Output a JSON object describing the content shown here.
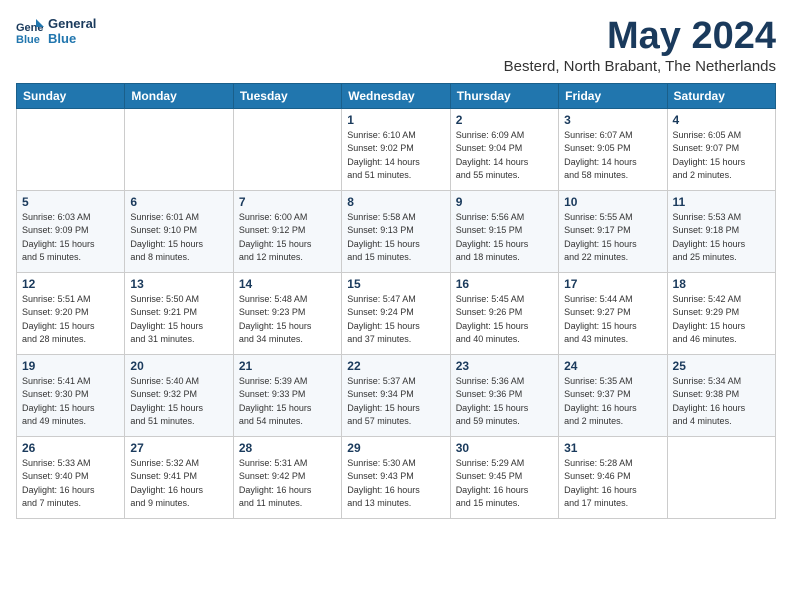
{
  "logo": {
    "line1": "General",
    "line2": "Blue"
  },
  "title": "May 2024",
  "subtitle": "Besterd, North Brabant, The Netherlands",
  "weekdays": [
    "Sunday",
    "Monday",
    "Tuesday",
    "Wednesday",
    "Thursday",
    "Friday",
    "Saturday"
  ],
  "weeks": [
    [
      {
        "day": "",
        "info": ""
      },
      {
        "day": "",
        "info": ""
      },
      {
        "day": "",
        "info": ""
      },
      {
        "day": "1",
        "info": "Sunrise: 6:10 AM\nSunset: 9:02 PM\nDaylight: 14 hours\nand 51 minutes."
      },
      {
        "day": "2",
        "info": "Sunrise: 6:09 AM\nSunset: 9:04 PM\nDaylight: 14 hours\nand 55 minutes."
      },
      {
        "day": "3",
        "info": "Sunrise: 6:07 AM\nSunset: 9:05 PM\nDaylight: 14 hours\nand 58 minutes."
      },
      {
        "day": "4",
        "info": "Sunrise: 6:05 AM\nSunset: 9:07 PM\nDaylight: 15 hours\nand 2 minutes."
      }
    ],
    [
      {
        "day": "5",
        "info": "Sunrise: 6:03 AM\nSunset: 9:09 PM\nDaylight: 15 hours\nand 5 minutes."
      },
      {
        "day": "6",
        "info": "Sunrise: 6:01 AM\nSunset: 9:10 PM\nDaylight: 15 hours\nand 8 minutes."
      },
      {
        "day": "7",
        "info": "Sunrise: 6:00 AM\nSunset: 9:12 PM\nDaylight: 15 hours\nand 12 minutes."
      },
      {
        "day": "8",
        "info": "Sunrise: 5:58 AM\nSunset: 9:13 PM\nDaylight: 15 hours\nand 15 minutes."
      },
      {
        "day": "9",
        "info": "Sunrise: 5:56 AM\nSunset: 9:15 PM\nDaylight: 15 hours\nand 18 minutes."
      },
      {
        "day": "10",
        "info": "Sunrise: 5:55 AM\nSunset: 9:17 PM\nDaylight: 15 hours\nand 22 minutes."
      },
      {
        "day": "11",
        "info": "Sunrise: 5:53 AM\nSunset: 9:18 PM\nDaylight: 15 hours\nand 25 minutes."
      }
    ],
    [
      {
        "day": "12",
        "info": "Sunrise: 5:51 AM\nSunset: 9:20 PM\nDaylight: 15 hours\nand 28 minutes."
      },
      {
        "day": "13",
        "info": "Sunrise: 5:50 AM\nSunset: 9:21 PM\nDaylight: 15 hours\nand 31 minutes."
      },
      {
        "day": "14",
        "info": "Sunrise: 5:48 AM\nSunset: 9:23 PM\nDaylight: 15 hours\nand 34 minutes."
      },
      {
        "day": "15",
        "info": "Sunrise: 5:47 AM\nSunset: 9:24 PM\nDaylight: 15 hours\nand 37 minutes."
      },
      {
        "day": "16",
        "info": "Sunrise: 5:45 AM\nSunset: 9:26 PM\nDaylight: 15 hours\nand 40 minutes."
      },
      {
        "day": "17",
        "info": "Sunrise: 5:44 AM\nSunset: 9:27 PM\nDaylight: 15 hours\nand 43 minutes."
      },
      {
        "day": "18",
        "info": "Sunrise: 5:42 AM\nSunset: 9:29 PM\nDaylight: 15 hours\nand 46 minutes."
      }
    ],
    [
      {
        "day": "19",
        "info": "Sunrise: 5:41 AM\nSunset: 9:30 PM\nDaylight: 15 hours\nand 49 minutes."
      },
      {
        "day": "20",
        "info": "Sunrise: 5:40 AM\nSunset: 9:32 PM\nDaylight: 15 hours\nand 51 minutes."
      },
      {
        "day": "21",
        "info": "Sunrise: 5:39 AM\nSunset: 9:33 PM\nDaylight: 15 hours\nand 54 minutes."
      },
      {
        "day": "22",
        "info": "Sunrise: 5:37 AM\nSunset: 9:34 PM\nDaylight: 15 hours\nand 57 minutes."
      },
      {
        "day": "23",
        "info": "Sunrise: 5:36 AM\nSunset: 9:36 PM\nDaylight: 15 hours\nand 59 minutes."
      },
      {
        "day": "24",
        "info": "Sunrise: 5:35 AM\nSunset: 9:37 PM\nDaylight: 16 hours\nand 2 minutes."
      },
      {
        "day": "25",
        "info": "Sunrise: 5:34 AM\nSunset: 9:38 PM\nDaylight: 16 hours\nand 4 minutes."
      }
    ],
    [
      {
        "day": "26",
        "info": "Sunrise: 5:33 AM\nSunset: 9:40 PM\nDaylight: 16 hours\nand 7 minutes."
      },
      {
        "day": "27",
        "info": "Sunrise: 5:32 AM\nSunset: 9:41 PM\nDaylight: 16 hours\nand 9 minutes."
      },
      {
        "day": "28",
        "info": "Sunrise: 5:31 AM\nSunset: 9:42 PM\nDaylight: 16 hours\nand 11 minutes."
      },
      {
        "day": "29",
        "info": "Sunrise: 5:30 AM\nSunset: 9:43 PM\nDaylight: 16 hours\nand 13 minutes."
      },
      {
        "day": "30",
        "info": "Sunrise: 5:29 AM\nSunset: 9:45 PM\nDaylight: 16 hours\nand 15 minutes."
      },
      {
        "day": "31",
        "info": "Sunrise: 5:28 AM\nSunset: 9:46 PM\nDaylight: 16 hours\nand 17 minutes."
      },
      {
        "day": "",
        "info": ""
      }
    ]
  ]
}
